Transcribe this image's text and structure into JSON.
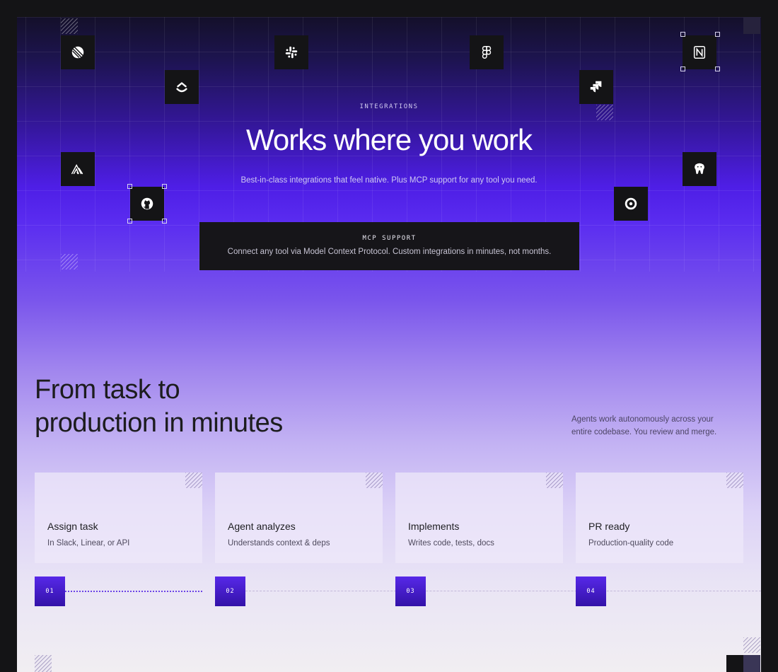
{
  "integrations": {
    "eyebrow": "INTEGRATIONS",
    "title": "Works where you work",
    "subtitle": "Best-in-class integrations that feel native. Plus MCP support for any tool you need.",
    "mcp": {
      "label": "MCP SUPPORT",
      "text": "Connect any tool via Model Context Protocol. Custom integrations in minutes, not months."
    },
    "icons": [
      "linear-icon",
      "clickup-icon",
      "slack-icon",
      "figma-icon",
      "jira-icon",
      "notion-icon",
      "sentry-icon",
      "github-icon",
      "circleci-icon",
      "postgresql-icon"
    ]
  },
  "workflow": {
    "title_line1": "From task to",
    "title_line2": "production in minutes",
    "subtitle": "Agents work autonomously across your entire codebase. You review and merge.",
    "steps": [
      {
        "number": "01",
        "title": "Assign task",
        "description": "In Slack, Linear, or API"
      },
      {
        "number": "02",
        "title": "Agent analyzes",
        "description": "Understands context & deps"
      },
      {
        "number": "03",
        "title": "Implements",
        "description": "Writes code, tests, docs"
      },
      {
        "number": "04",
        "title": "PR ready",
        "description": "Production-quality code"
      }
    ]
  },
  "colors": {
    "accent": "#5a2cf0",
    "tile": "#141416",
    "background": "#141416"
  }
}
